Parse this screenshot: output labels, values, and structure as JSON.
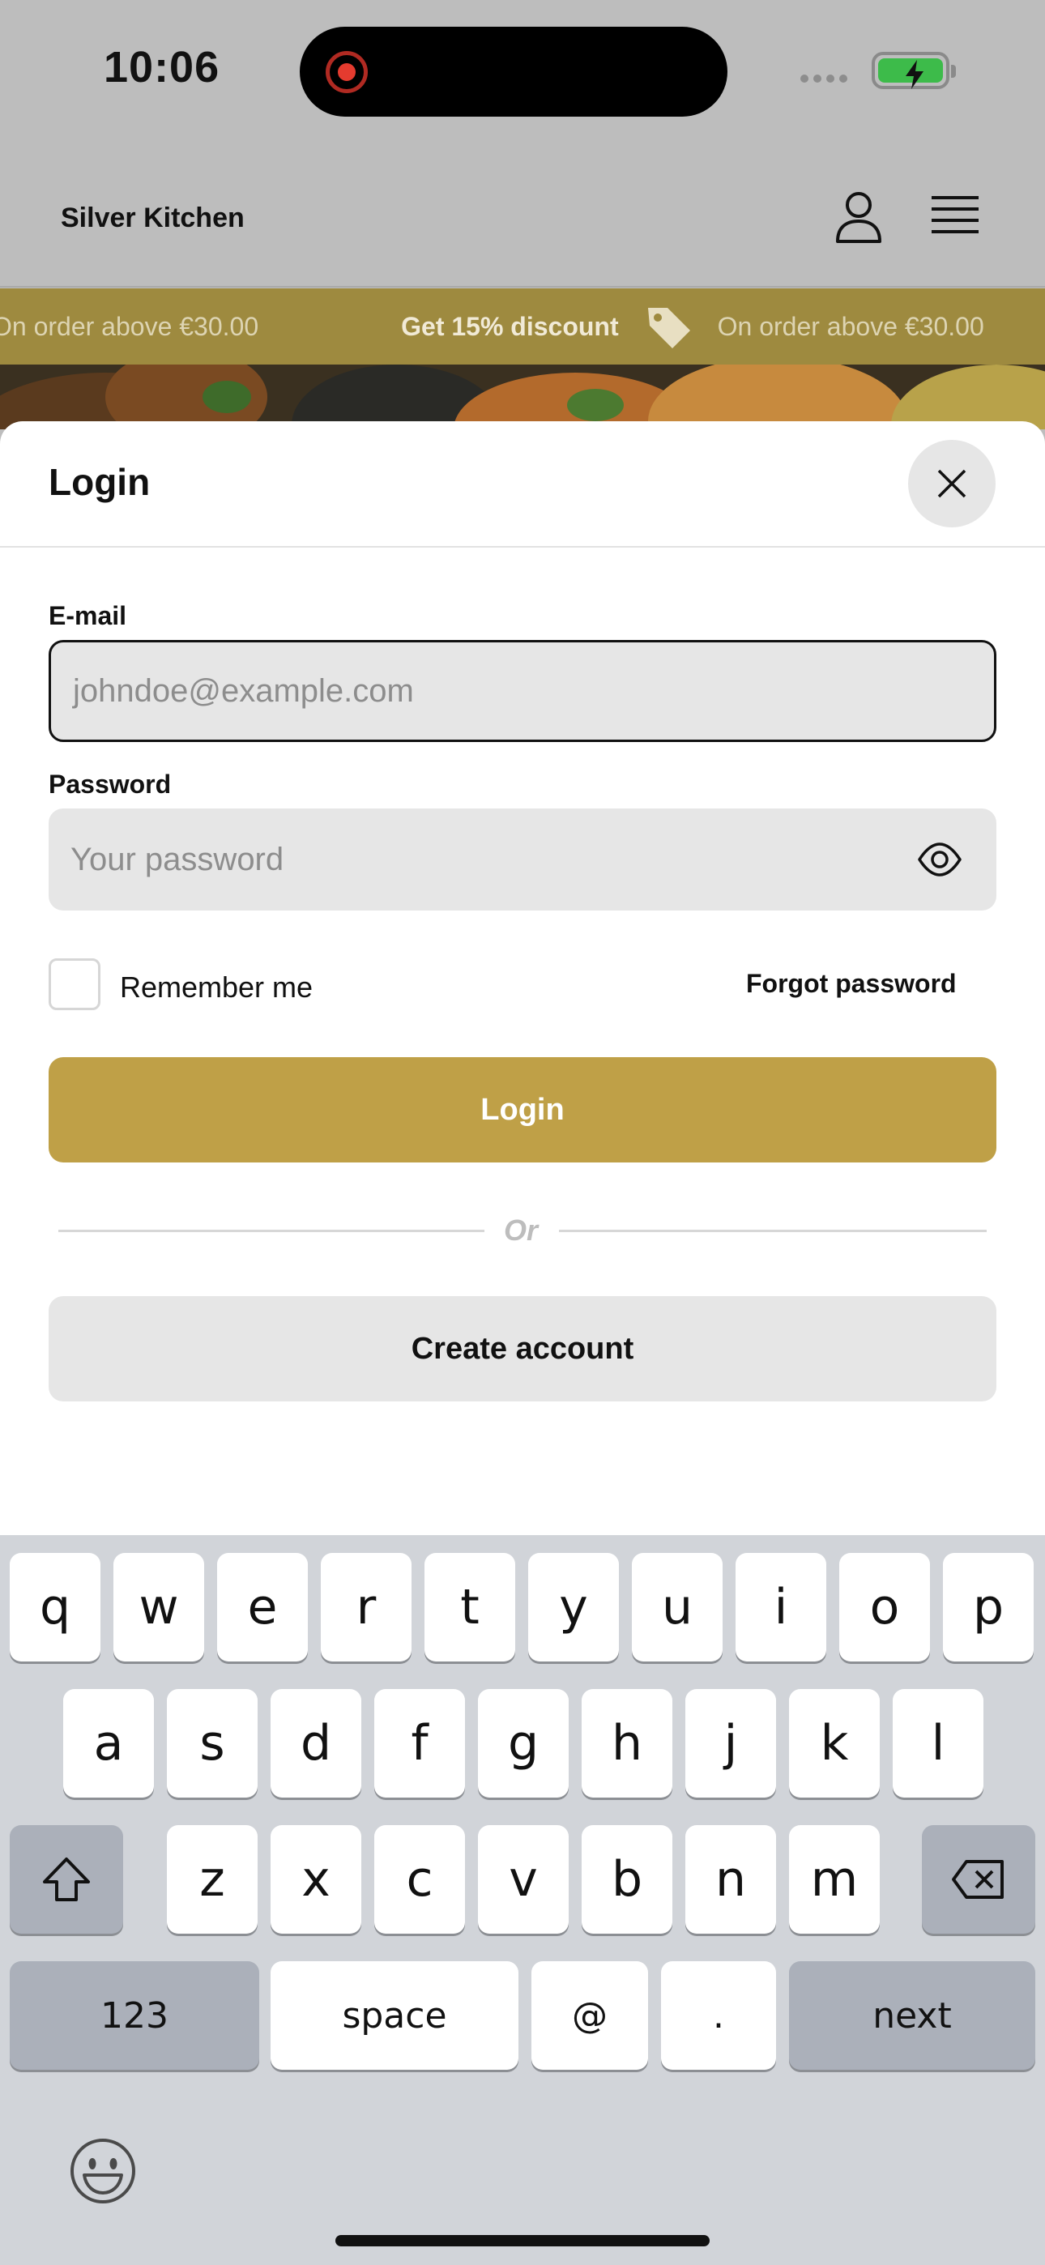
{
  "status_bar": {
    "time": "10:06"
  },
  "header": {
    "brand": "Silver Kitchen"
  },
  "promo": {
    "items": [
      "On order above €30.00",
      "Get 15% discount",
      "On order above €30.00"
    ]
  },
  "login_sheet": {
    "title": "Login",
    "email_label": "E-mail",
    "email_placeholder": "johndoe@example.com",
    "password_label": "Password",
    "password_placeholder": "Your password",
    "remember_label": "Remember me",
    "forgot_label": "Forgot password",
    "login_button": "Login",
    "divider_text": "Or",
    "create_account_button": "Create account"
  },
  "keyboard": {
    "row1": [
      "q",
      "w",
      "e",
      "r",
      "t",
      "y",
      "u",
      "i",
      "o",
      "p"
    ],
    "row2": [
      "a",
      "s",
      "d",
      "f",
      "g",
      "h",
      "j",
      "k",
      "l"
    ],
    "row3": [
      "z",
      "x",
      "c",
      "v",
      "b",
      "n",
      "m"
    ],
    "numbers": "123",
    "space": "space",
    "at": "@",
    "period": ".",
    "next": "next"
  },
  "colors": {
    "accent": "#bfa047",
    "promo_bg": "#9e8a3f",
    "overlay_bg": "#bdbdbd",
    "field_bg": "#e6e6e6"
  },
  "icons": [
    "record-indicator-icon",
    "battery-charging-icon",
    "user-icon",
    "menu-icon",
    "tag-icon",
    "close-icon",
    "eye-icon",
    "shift-icon",
    "backspace-icon",
    "emoji-icon"
  ]
}
